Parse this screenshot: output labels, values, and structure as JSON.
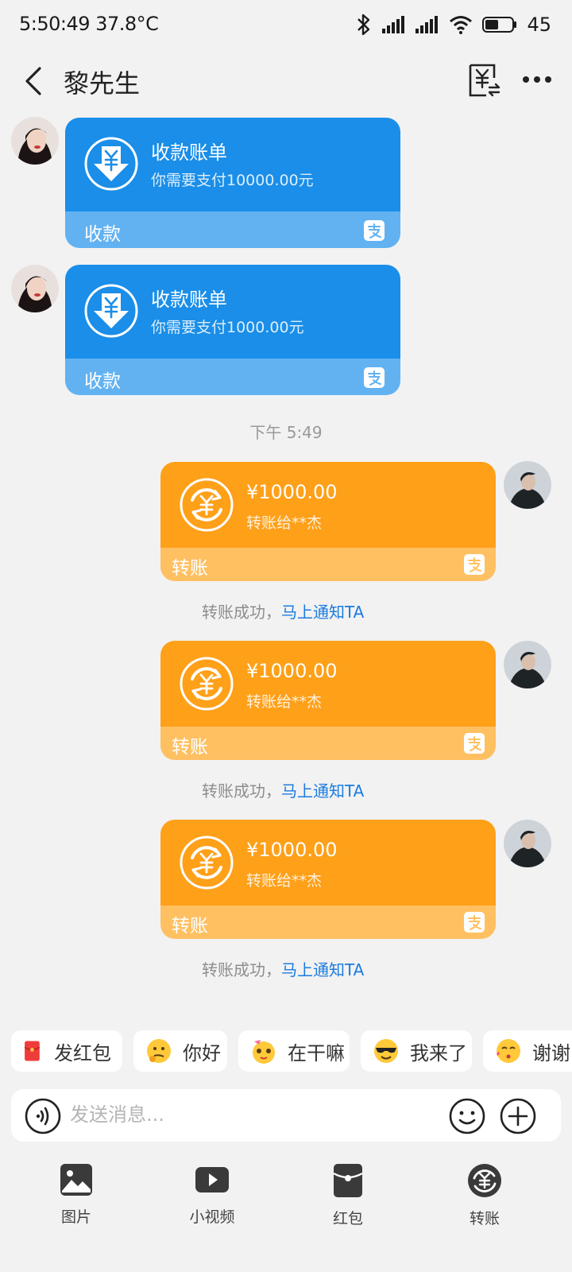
{
  "status_bar": {
    "time": "5:50:49",
    "temperature": "37.8°C",
    "battery": "45"
  },
  "header": {
    "title": "黎先生"
  },
  "messages": {
    "payment_requests": [
      {
        "title": "收款账单",
        "subtitle": "你需要支付10000.00元",
        "footer": "收款"
      },
      {
        "title": "收款账单",
        "subtitle": "你需要支付1000.00元",
        "footer": "收款"
      }
    ],
    "time_separator": "下午 5:49",
    "transfers": [
      {
        "amount": "¥1000.00",
        "recipient": "转账给**杰",
        "footer": "转账",
        "notice_text": "转账成功，",
        "notice_link": "马上通知TA"
      },
      {
        "amount": "¥1000.00",
        "recipient": "转账给**杰",
        "footer": "转账",
        "notice_text": "转账成功，",
        "notice_link": "马上通知TA"
      },
      {
        "amount": "¥1000.00",
        "recipient": "转账给**杰",
        "footer": "转账",
        "notice_text": "转账成功，",
        "notice_link": "马上通知TA"
      }
    ]
  },
  "quick_replies": [
    {
      "label": "发红包",
      "icon": "red-envelope-icon"
    },
    {
      "label": "你好",
      "icon": "thinking-emoji-icon"
    },
    {
      "label": "在干嘛",
      "icon": "cute-emoji-icon"
    },
    {
      "label": "我来了",
      "icon": "sunglasses-emoji-icon"
    },
    {
      "label": "谢谢",
      "icon": "kiss-emoji-icon"
    }
  ],
  "input": {
    "placeholder": "发送消息..."
  },
  "toolbar": [
    {
      "label": "图片",
      "icon": "image-icon"
    },
    {
      "label": "小视频",
      "icon": "video-icon"
    },
    {
      "label": "红包",
      "icon": "red-packet-icon"
    },
    {
      "label": "转账",
      "icon": "transfer-icon"
    }
  ],
  "colors": {
    "blue_card": "#1a8ee8",
    "blue_card_footer": "#62b2f1",
    "orange_card": "#ffa019",
    "orange_card_footer": "#ffc062",
    "link": "#1a7ce0",
    "background": "#f2f2f2"
  }
}
